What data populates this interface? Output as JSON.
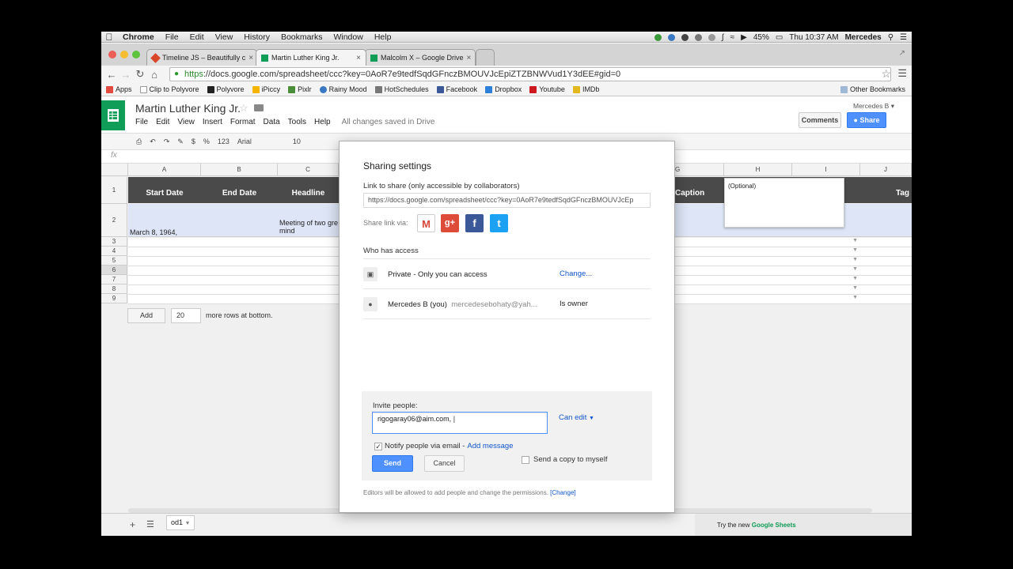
{
  "menubar": {
    "app": "Chrome",
    "items": [
      "File",
      "Edit",
      "View",
      "History",
      "Bookmarks",
      "Window",
      "Help"
    ],
    "battery": "45%",
    "clock": "Thu 10:37 AM",
    "user": "Mercedes"
  },
  "tabs": [
    {
      "title": "Timeline JS – Beautifully c",
      "favicon_color": "#d9472b"
    },
    {
      "title": "Martin Luther King Jr.",
      "favicon_color": "#0f9d58"
    },
    {
      "title": "Malcolm X – Google Drive",
      "favicon_color": "#0f9d58"
    }
  ],
  "address": {
    "scheme": "https",
    "rest": "://docs.google.com/spreadsheet/ccc?key=0AoR7e9tedfSqdGFnczBMOUVJcEpiZTZBNWVud1Y3dEE#gid=0"
  },
  "bookmarks": {
    "items": [
      {
        "label": "Apps",
        "color": "#e04a3f"
      },
      {
        "label": "Clip to Polyvore",
        "color": "#ffffff"
      },
      {
        "label": "Polyvore",
        "color": "#222222"
      },
      {
        "label": "iPiccy",
        "color": "#f4b400"
      },
      {
        "label": "Pixlr",
        "color": "#4a8e3a"
      },
      {
        "label": "Rainy Mood",
        "color": "#3b78c4"
      },
      {
        "label": "HotSchedules",
        "color": "#777777"
      },
      {
        "label": "Facebook",
        "color": "#3b5998"
      },
      {
        "label": "Dropbox",
        "color": "#2e7fd9"
      },
      {
        "label": "Youtube",
        "color": "#cc181e"
      },
      {
        "label": "IMDb",
        "color": "#e3b81f"
      }
    ],
    "other": "Other Bookmarks"
  },
  "doc": {
    "title": "Martin Luther King Jr.",
    "menu": [
      "File",
      "Edit",
      "View",
      "Insert",
      "Format",
      "Data",
      "Tools",
      "Help"
    ],
    "saved_status": "All changes saved in Drive",
    "user": "Mercedes B",
    "comments_label": "Comments",
    "share_label": "Share"
  },
  "formatbar": {
    "items": [
      "$",
      "%",
      "123",
      "Arial",
      "10"
    ]
  },
  "fx_label": "fx",
  "grid": {
    "columns": [
      "A",
      "B",
      "C",
      "G",
      "H",
      "I",
      "J"
    ],
    "row_numbers": [
      "1",
      "2",
      "3",
      "4",
      "5",
      "6",
      "7",
      "8",
      "9"
    ],
    "headers": {
      "a": "Start Date",
      "b": "End Date",
      "c": "Headline",
      "g": "Caption",
      "j": "Tag"
    },
    "row2": {
      "a": "March 8, 1964,",
      "c_line1": "Meeting of two gre",
      "c_line2": "mind"
    },
    "optional_note": "(Optional)",
    "add_label": "Add",
    "rows_value": "20",
    "rows_suffix": "more rows at bottom."
  },
  "sheetbar": {
    "sheet_tab": "od1",
    "try_prefix": "Try the new ",
    "try_brand": "Google Sheets"
  },
  "dialog": {
    "title": "Sharing settings",
    "link_label": "Link to share (only accessible by collaborators)",
    "link_value": "https://docs.google.com/spreadsheet/ccc?key=0AoR7e9tedfSqdGFnczBMOUVJcEp",
    "share_via": "Share link via:",
    "who_label": "Who has access",
    "access": [
      {
        "name": "Private - Only you can access",
        "action": "Change..."
      },
      {
        "name": "Mercedes B (you)",
        "email": "mercedesebohaty@yah...",
        "role": "Is owner"
      }
    ],
    "invite_label": "Invite people:",
    "invite_value": "rigogaray06@aim.com,",
    "permission": "Can edit",
    "notify_label": "Notify people via email -",
    "add_message": "Add message",
    "send_label": "Send",
    "cancel_label": "Cancel",
    "send_copy": "Send a copy to myself",
    "footer": "Editors will be allowed to add people and change the permissions.",
    "footer_link": "[Change]"
  }
}
